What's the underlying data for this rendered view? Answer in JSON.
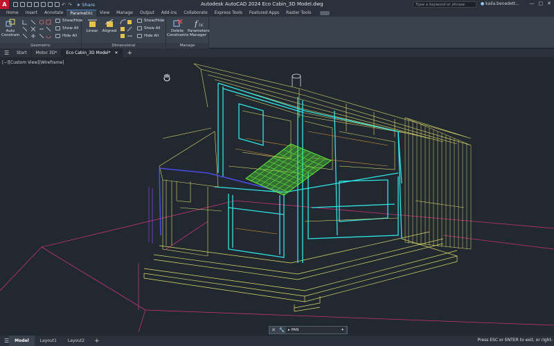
{
  "app": {
    "logo": "A",
    "title": "Autodesk AutoCAD 2024   Eco Cabin_3D Model.dwg",
    "share_label": "Share",
    "search_placeholder": "Type a keyword or phrase",
    "user_name": "kaila.benedett...",
    "window_controls": [
      "—",
      "▢",
      "✕"
    ]
  },
  "ribbon_tabs": [
    "Home",
    "Insert",
    "Annotate",
    "Parametric",
    "View",
    "Manage",
    "Output",
    "Add-ins",
    "Collaborate",
    "Express Tools",
    "Featured Apps",
    "Raster Tools"
  ],
  "active_ribbon_tab": "Parametric",
  "ribbon": {
    "geometric": {
      "title": "Geometric",
      "auto_constrain": "Auto Constrain",
      "show_hide": "Show/Hide",
      "show_all": "Show All",
      "hide_all": "Hide All"
    },
    "dimensional": {
      "title": "Dimensional",
      "linear": "Linear",
      "aligned": "Aligned",
      "show_hide": "Show/Hide",
      "show_all": "Show All",
      "hide_all": "Hide All"
    },
    "manage": {
      "title": "Manage",
      "delete_constraints": "Delete Constraints",
      "parameters_manager": "Parameters Manager"
    }
  },
  "file_tabs": [
    {
      "label": "Start",
      "active": false
    },
    {
      "label": "Motor 3D*",
      "active": false
    },
    {
      "label": "Eco Cabin_3D Model*",
      "active": true
    }
  ],
  "viewport": {
    "label": "[−][Custom View][Wireframe]"
  },
  "command_line": {
    "prompt_icon": "⌨",
    "value": "PAN"
  },
  "layout_tabs": [
    {
      "label": "Model",
      "active": true
    },
    {
      "label": "Layout1",
      "active": false
    },
    {
      "label": "Layout2",
      "active": false
    }
  ],
  "status_message": "Press ESC or ENTER to exit, or right-",
  "colors": {
    "background": "#212830",
    "ribbon": "#3a424d",
    "wire_yellow": "#e6e06a",
    "wire_cyan": "#2fe6e6",
    "wire_green": "#5cf03a",
    "wire_magenta": "#c8327a",
    "wire_blue": "#4a4ae6",
    "accent": "#c2152b"
  },
  "icons": {
    "app": "autocad-logo-icon",
    "pan_cursor": "hand-pan-icon"
  }
}
